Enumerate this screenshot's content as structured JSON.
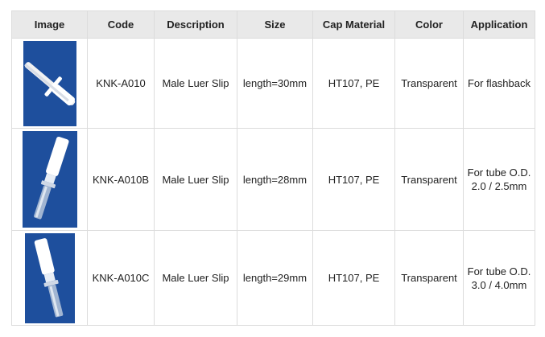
{
  "table": {
    "headers": [
      "Image",
      "Code",
      "Description",
      "Size",
      "Cap Material",
      "Color",
      "Application"
    ],
    "rows": [
      {
        "image_icon": "luer-connector-flashback-photo",
        "code": "KNK-A010",
        "description": "Male Luer Slip",
        "size": "length=30mm",
        "cap_material": "HT107, PE",
        "color": "Transparent",
        "application": "For flashback"
      },
      {
        "image_icon": "luer-connector-tube-photo",
        "code": "KNK-A010B",
        "description": "Male Luer Slip",
        "size": "length=28mm",
        "cap_material": "HT107, PE",
        "color": "Transparent",
        "application": "For tube O.D. 2.0 / 2.5mm"
      },
      {
        "image_icon": "luer-connector-tube-photo",
        "code": "KNK-A010C",
        "description": "Male Luer Slip",
        "size": "length=29mm",
        "cap_material": "HT107, PE",
        "color": "Transparent",
        "application": "For tube O.D. 3.0 / 4.0mm"
      }
    ]
  },
  "colors": {
    "header_bg": "#e9e9e9",
    "border": "#dcdcdc",
    "photo_bg": "#1e4f9d"
  }
}
